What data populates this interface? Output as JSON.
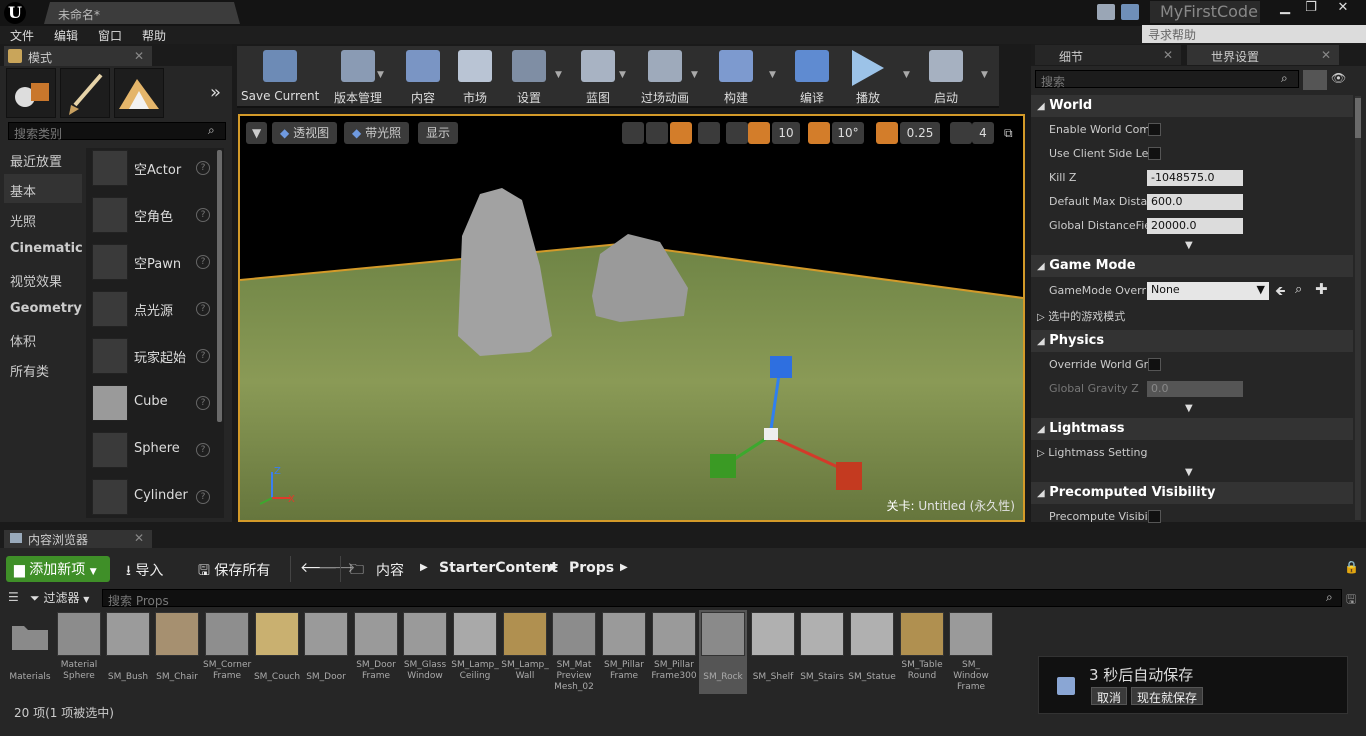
{
  "window": {
    "doc_tab": "未命名*",
    "project": "MyFirstCode",
    "help_search": "寻求帮助"
  },
  "menu": [
    "文件",
    "编辑",
    "窗口",
    "帮助"
  ],
  "modes": {
    "tab": "模式",
    "search_placeholder": "搜索类别",
    "categories": [
      "最近放置",
      "基本",
      "光照",
      "Cinematic",
      "视觉效果",
      "Geometry",
      "体积",
      "所有类"
    ],
    "actors": [
      "空Actor",
      "空角色",
      "空Pawn",
      "点光源",
      "玩家起始",
      "Cube",
      "Sphere",
      "Cylinder"
    ]
  },
  "toolbar": [
    "Save Current",
    "版本管理",
    "内容",
    "市场",
    "设置",
    "蓝图",
    "过场动画",
    "构建",
    "编译",
    "播放",
    "启动"
  ],
  "viewport": {
    "perspective": "透视图",
    "lit": "带光照",
    "show": "显示",
    "grid": "10",
    "rot": "10°",
    "scale": "0.25",
    "speed": "4",
    "level_prefix": "关卡: ",
    "level_name": "Untitled (永久性)"
  },
  "details": {
    "tab_detail": "细节",
    "tab_world": "世界设置",
    "search_placeholder": "搜索",
    "world": {
      "title": "World",
      "enable_comp": "Enable World Comp",
      "client_side": "Use Client Side Le",
      "kill_z_label": "Kill Z",
      "kill_z": "-1048575.0",
      "max_dist_label": "Default Max Distar",
      "max_dist": "600.0",
      "gdf_label": "Global DistanceFie",
      "gdf": "20000.0"
    },
    "gamemode": {
      "title": "Game Mode",
      "override_label": "GameMode Overri",
      "override": "None",
      "selected": "选中的游戏模式"
    },
    "physics": {
      "title": "Physics",
      "override_gravity": "Override World Gra",
      "gravity_label": "Global Gravity Z",
      "gravity": "0.0"
    },
    "lightmass": {
      "title": "Lightmass",
      "settings": "Lightmass Setting"
    },
    "precomputed": {
      "title": "Precomputed Visibility",
      "precompute": "Precompute Visibi"
    }
  },
  "content": {
    "tab": "内容浏览器",
    "add": "添加新项",
    "import": "导入",
    "save_all": "保存所有",
    "path": [
      "内容",
      "StarterContent",
      "Props"
    ],
    "filter": "过滤器",
    "search_placeholder": "搜索 Props",
    "assets": [
      [
        "Materials"
      ],
      [
        "Material",
        "Sphere"
      ],
      [
        "SM_Bush"
      ],
      [
        "SM_Chair"
      ],
      [
        "SM_Corner",
        "Frame"
      ],
      [
        "SM_Couch"
      ],
      [
        "SM_Door"
      ],
      [
        "SM_Door",
        "Frame"
      ],
      [
        "SM_Glass",
        "Window"
      ],
      [
        "SM_Lamp_",
        "Ceiling"
      ],
      [
        "SM_Lamp_",
        "Wall"
      ],
      [
        "SM_Mat",
        "Preview",
        "Mesh_02"
      ],
      [
        "SM_Pillar",
        "Frame"
      ],
      [
        "SM_Pillar",
        "Frame300"
      ],
      [
        "SM_Rock"
      ],
      [
        "SM_Shelf"
      ],
      [
        "SM_Stairs"
      ],
      [
        "SM_Statue"
      ],
      [
        "SM_Table",
        "Round"
      ],
      [
        "SM_",
        "Window",
        "Frame"
      ]
    ],
    "status": "20 项(1 项被选中)"
  },
  "autosave": {
    "msg": "3 秒后自动保存",
    "cancel": "取消",
    "save_now": "现在就保存"
  }
}
